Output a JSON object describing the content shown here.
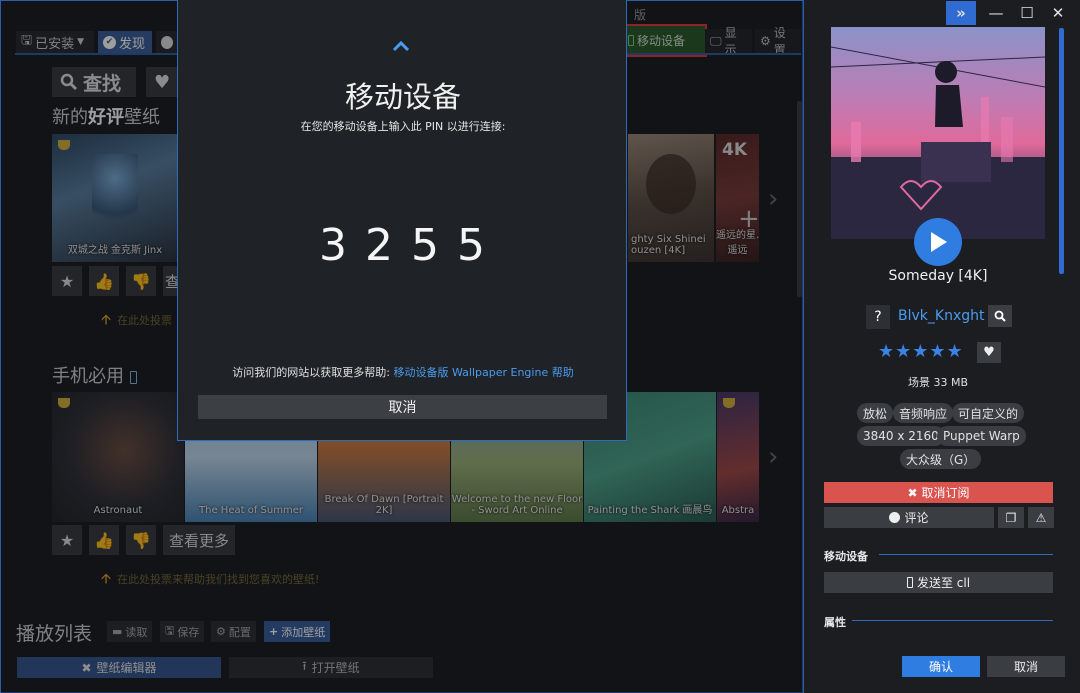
{
  "library_tabs": {
    "installed": "已安装",
    "discover": "发现"
  },
  "version_partial": "版",
  "toolbar": {
    "mobile": "移动设备",
    "display": "显示",
    "settings": "设置"
  },
  "search": {
    "label": "查找"
  },
  "sections": {
    "new_rated_prefix": "新的",
    "new_rated_bold": "好评",
    "new_rated_suffix": "壁纸",
    "mobile_must": "手机必用"
  },
  "row1_cards": [
    {
      "caption": "双城之战 金克斯 Jinx"
    },
    {
      "caption": "ghty Six Shinei\nouzen [4K]"
    },
    {
      "caption": "遥远的星…\n遥远"
    }
  ],
  "row2_cards": [
    {
      "caption": "Astronaut"
    },
    {
      "caption": "The Heat of Summer"
    },
    {
      "caption": "Break Of Dawn [Portrait 2K]"
    },
    {
      "caption": "Welcome to the new Floor - Sword Art Online"
    },
    {
      "caption": "Painting the Shark 画晨鸟"
    },
    {
      "caption": "Abstra"
    }
  ],
  "card_badge": "4K",
  "row_actions": {
    "more": "查看更多",
    "more_partial": "查"
  },
  "hints": {
    "vote_full": "在此处投票来帮助我们找到您喜欢的壁纸!",
    "vote_partial": "在此处投票"
  },
  "playlist": {
    "title": "播放列表",
    "load": "读取",
    "save": "保存",
    "config": "配置",
    "add": "添加壁纸"
  },
  "bottom": {
    "editor": "壁纸编辑器",
    "open": "打开壁纸"
  },
  "dialog": {
    "title": "移动设备",
    "subtitle": "在您的移动设备上输入此 PIN 以进行连接:",
    "pin": "3 2 5 5",
    "help_prefix": "访问我们的网站以获取更多帮助:",
    "help_link": "移动设备版 Wallpaper Engine 帮助",
    "cancel": "取消"
  },
  "preview": {
    "title": "Someday [4K]",
    "author_badge": "?",
    "author": "Blvk_Knxght",
    "stars": "★★★★★",
    "meta": "场景 33 MB",
    "tags": [
      "放松",
      "音频响应",
      "可自定义的",
      "3840 x 2160",
      "Puppet Warp",
      "大众级（G）"
    ],
    "unsubscribe": "取消订阅",
    "comment": "评论",
    "mobile_header": "移动设备",
    "send_to": "发送至 cll",
    "props_header": "属性",
    "ok": "确认",
    "cancel": "取消"
  },
  "colors": {
    "accent": "#2f6bb8",
    "danger": "#d9534f",
    "link": "#4a9cf0",
    "hint_arrow": "#e8a33a",
    "star": "#3b82e6"
  },
  "icons": [
    "save-icon",
    "steam-icon",
    "search-icon",
    "heart-icon",
    "phone-icon",
    "monitor-icon",
    "gear-icon",
    "trophy-icon",
    "star-icon",
    "thumbs-up-icon",
    "thumbs-down-icon",
    "arrow-up-icon",
    "chevron-right-icon",
    "chevron-up-icon",
    "play-icon",
    "close-icon",
    "comment-icon",
    "copy-icon",
    "warning-icon",
    "minimize-icon",
    "maximize-icon",
    "double-chevron-icon"
  ]
}
